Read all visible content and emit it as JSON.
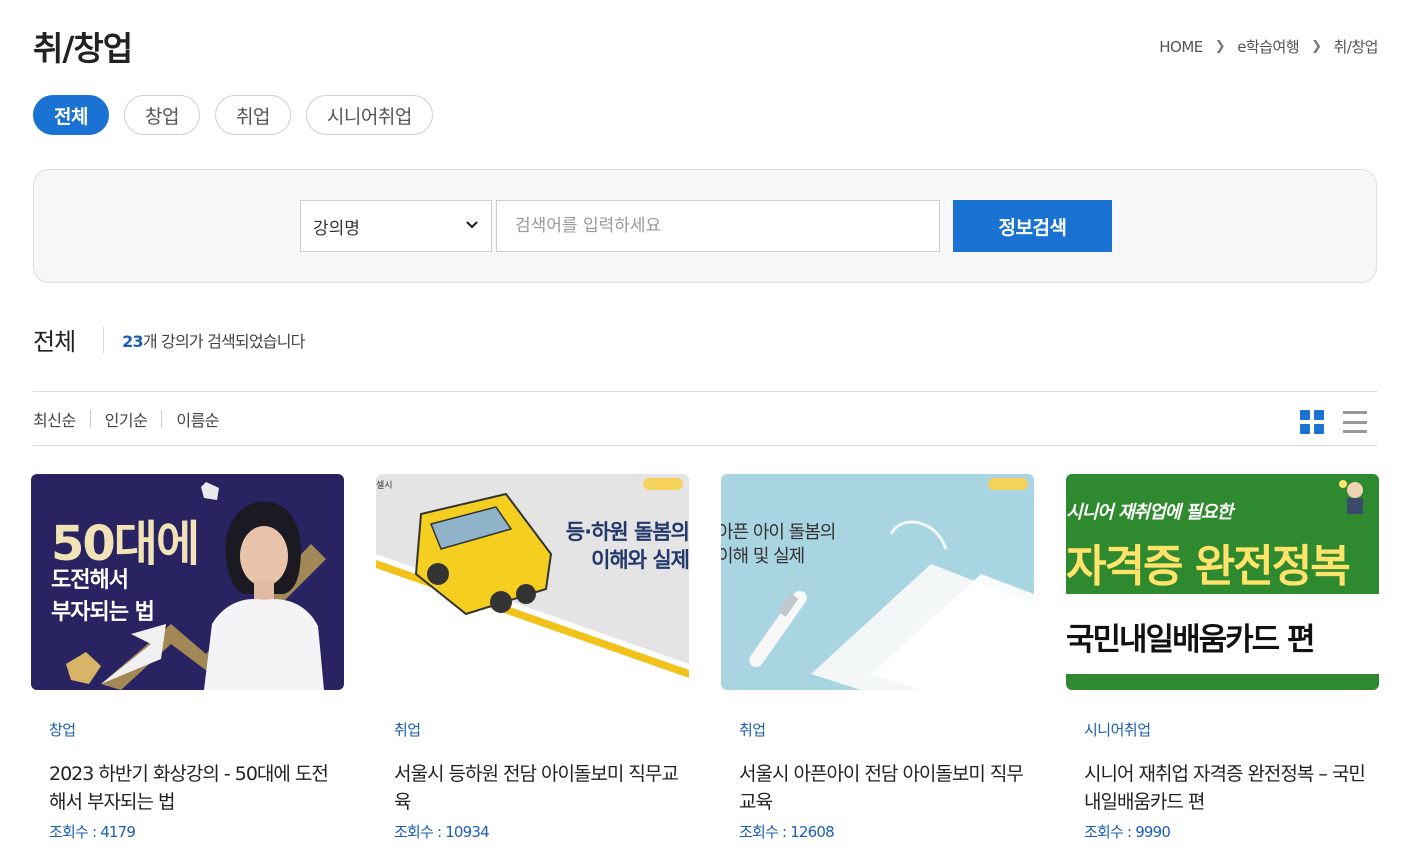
{
  "page": {
    "title": "취/창업"
  },
  "breadcrumb": {
    "items": [
      "HOME",
      "e학습여행",
      "취/창업"
    ]
  },
  "tabs": [
    {
      "label": "전체",
      "active": true
    },
    {
      "label": "창업",
      "active": false
    },
    {
      "label": "취업",
      "active": false
    },
    {
      "label": "시니어취업",
      "active": false
    }
  ],
  "search": {
    "select_value": "강의명",
    "placeholder": "검색어를 입력하세요",
    "button_label": "정보검색"
  },
  "results": {
    "title": "전체",
    "count": "23",
    "count_suffix": "개 강의가 검색되었습니다"
  },
  "sort": {
    "options": [
      "최신순",
      "인기순",
      "이름순"
    ]
  },
  "view_toggle": {
    "grid_icon": "grid-icon",
    "list_icon": "list-icon",
    "active": "grid"
  },
  "colors": {
    "accent": "#1a73d2",
    "link": "#1a5fb4"
  },
  "cards": [
    {
      "category": "창업",
      "title": "2023 하반기 화상강의 - 50대에 도전해서 부자되는 법",
      "views": "조회수 : 4179",
      "thumb": {
        "big": "50대에",
        "line1": "도전해서",
        "line2": "부자되는 법"
      }
    },
    {
      "category": "취업",
      "title": "서울시 등하원 전담 아이돌보미 직무교육",
      "views": "조회수 : 10934",
      "thumb": {
        "tag": "셀시",
        "line1": "등·하원 돌봄의",
        "line2": "이해와 실제"
      }
    },
    {
      "category": "취업",
      "title": "서울시 아픈아이 전담 아이돌보미 직무교육",
      "views": "조회수 : 12608",
      "thumb": {
        "line1": "아픈 아이 돌봄의",
        "line2": "이해 및 실제"
      }
    },
    {
      "category": "시니어취업",
      "title": "시니어 재취업 자격증 완전정복 – 국민내일배움카드 편",
      "views": "조회수 : 9990",
      "thumb": {
        "line1": "시니어 재취업에 필요한",
        "line2": "자격증 완전정복",
        "line3": "국민내일배움카드 편"
      }
    }
  ]
}
